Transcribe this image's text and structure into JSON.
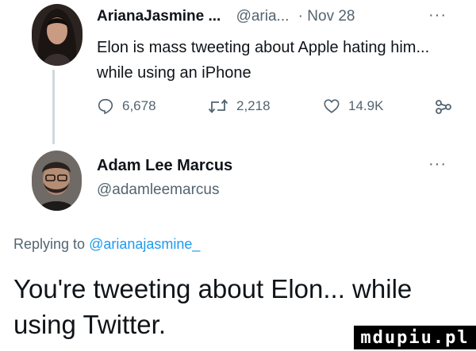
{
  "tweet1": {
    "display_name": "ArianaJasmine ...",
    "handle": "@aria...",
    "separator": " · ",
    "date": "Nov 28",
    "more_label": "···",
    "text": "Elon is mass tweeting about Apple hating him... while using an iPhone",
    "replies": "6,678",
    "retweets": "2,218",
    "likes": "14.9K"
  },
  "tweet2": {
    "display_name": "Adam Lee Marcus",
    "handle": "@adamleemarcus",
    "more_label": "···",
    "replying_prefix": "Replying to ",
    "replying_handle": "@arianajasmine_",
    "text": "You're tweeting about Elon... while using Twitter."
  },
  "watermark": "mdupiu.pl",
  "colors": {
    "text": "#0f1419",
    "muted": "#536471",
    "link": "#1d9bf0",
    "thread_line": "#cfd9de"
  },
  "icons": {
    "reply": "speech-bubble-icon",
    "retweet": "retweet-arrows-icon",
    "like": "heart-icon",
    "share": "share-nodes-icon"
  }
}
